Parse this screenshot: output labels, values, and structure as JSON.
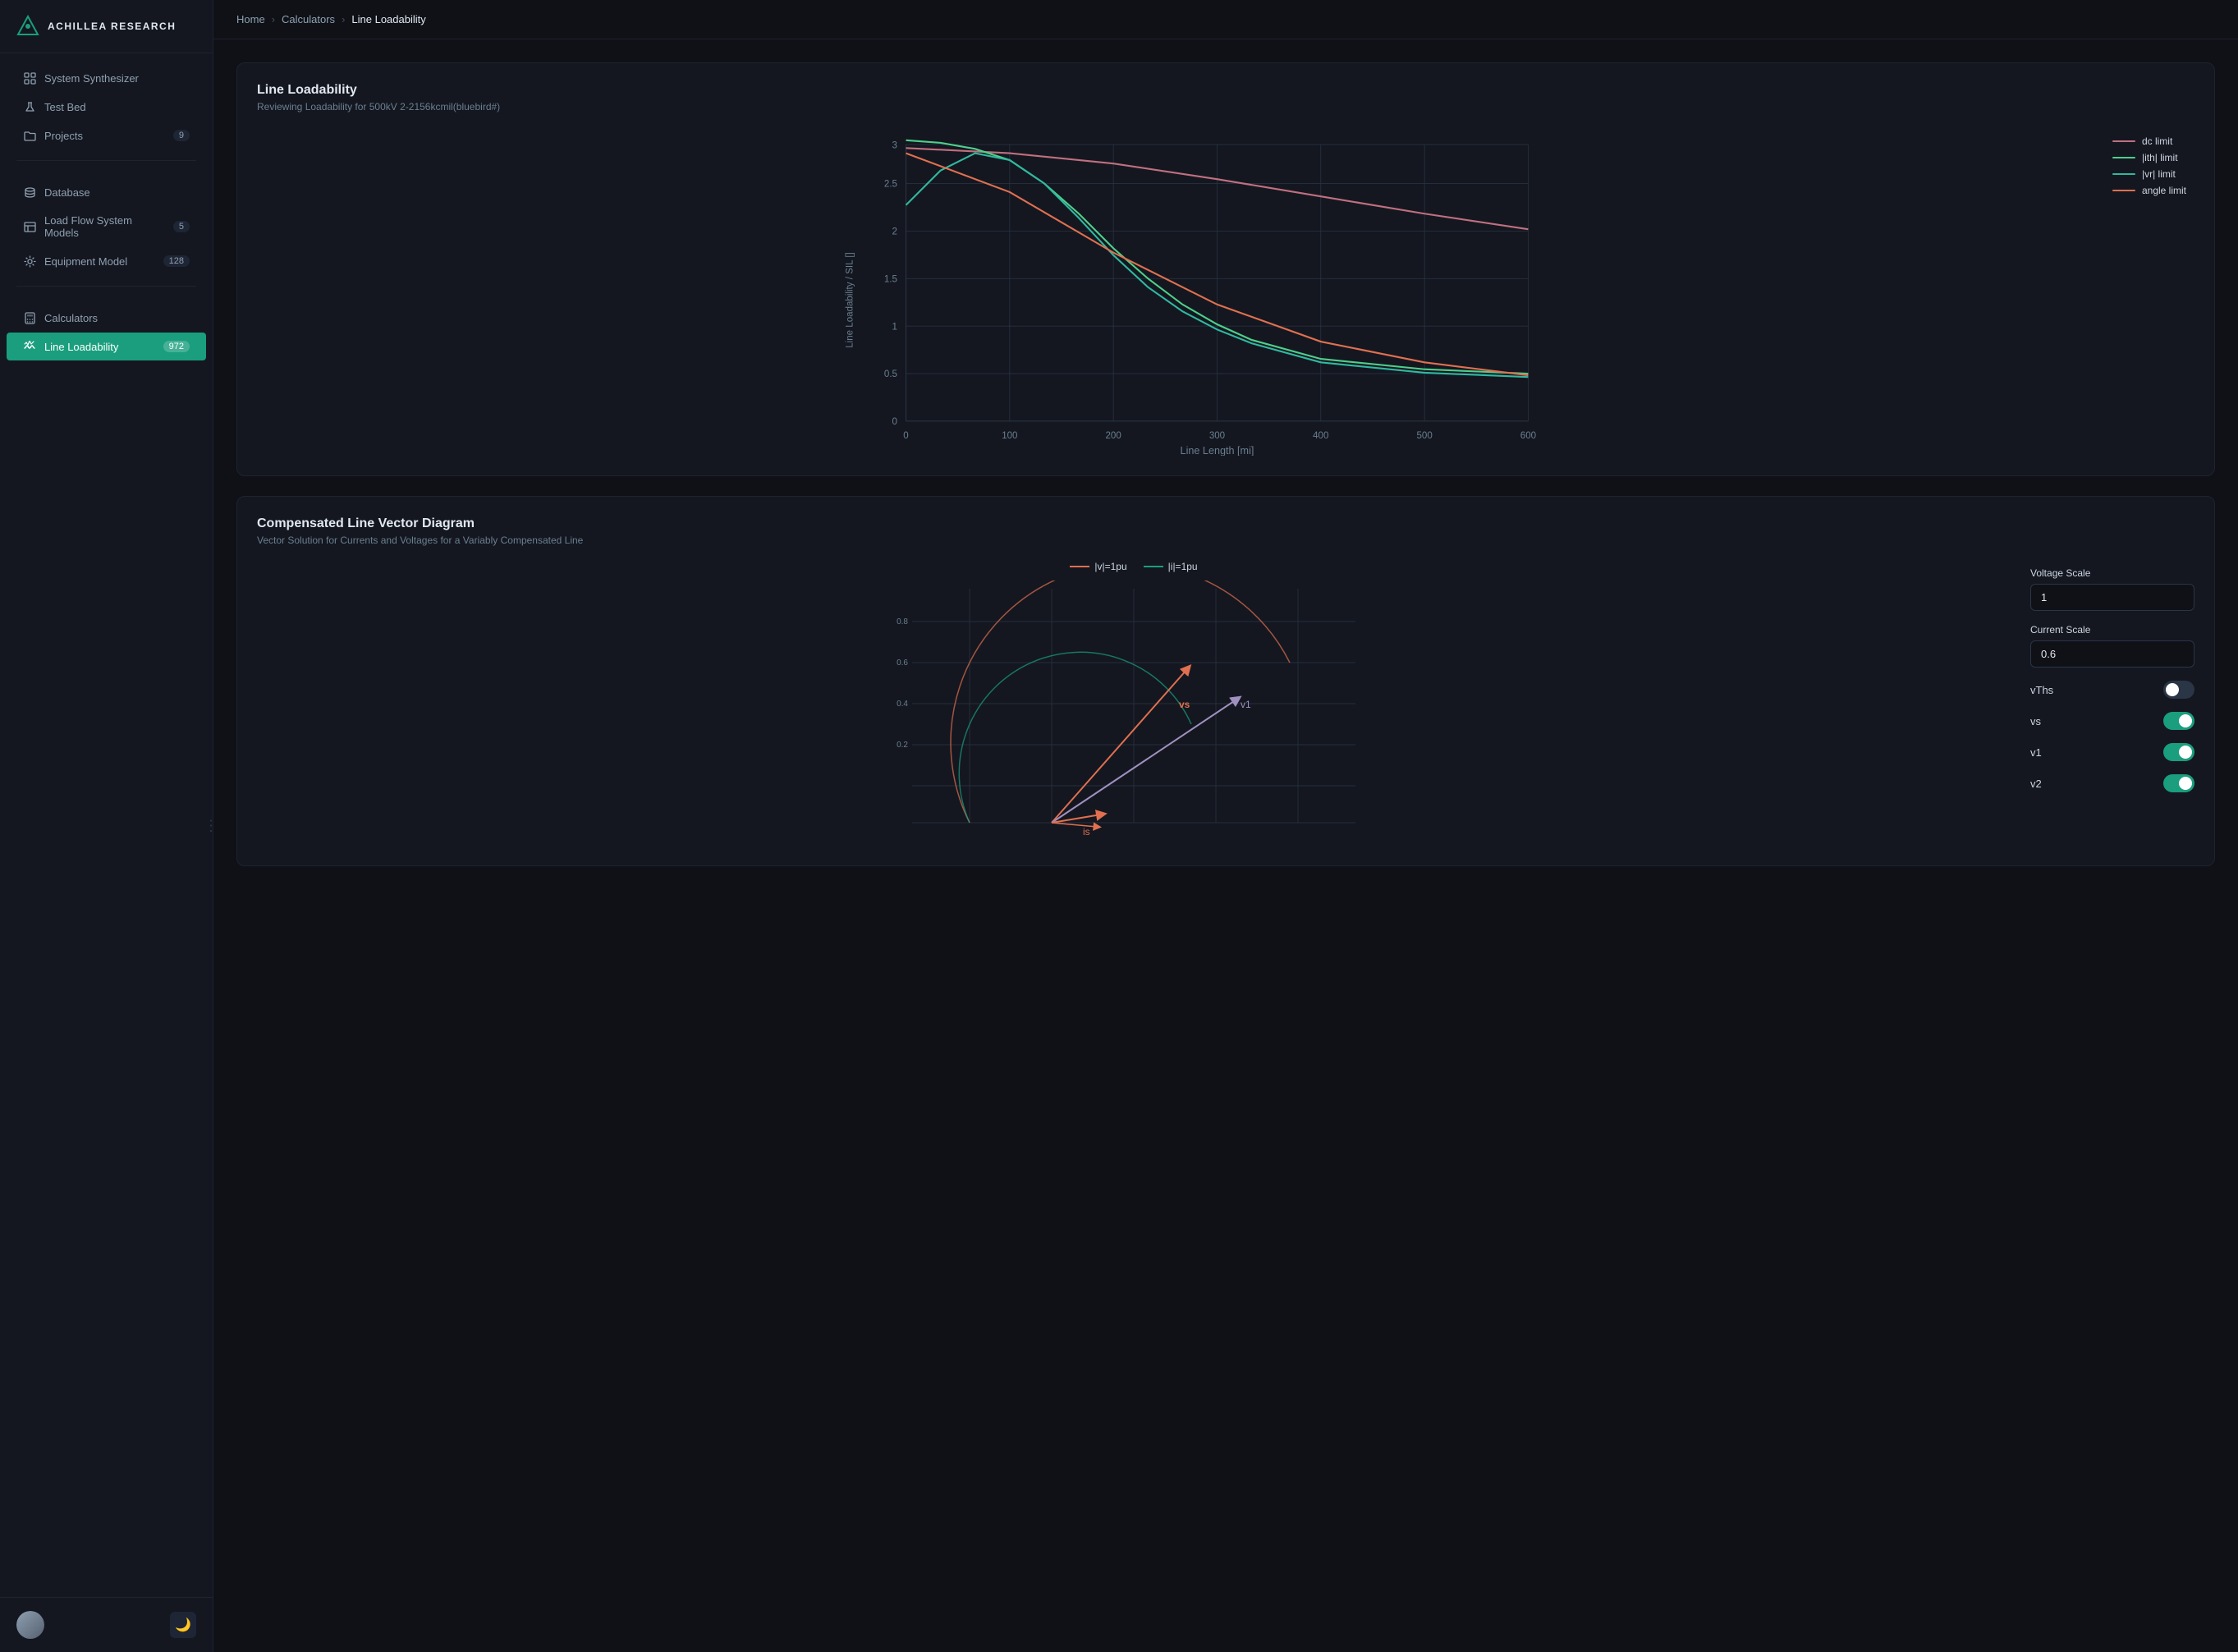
{
  "app": {
    "name": "ACHILLEA RESEARCH"
  },
  "breadcrumb": {
    "home": "Home",
    "calculators": "Calculators",
    "current": "Line Loadability"
  },
  "sidebar": {
    "items": [
      {
        "id": "system-synthesizer",
        "label": "System Synthesizer",
        "icon": "grid",
        "badge": null,
        "active": false
      },
      {
        "id": "test-bed",
        "label": "Test Bed",
        "icon": "flask",
        "badge": null,
        "active": false
      },
      {
        "id": "projects",
        "label": "Projects",
        "icon": "folder",
        "badge": "9",
        "active": false
      },
      {
        "id": "database",
        "label": "Database",
        "icon": "database",
        "badge": null,
        "active": false
      },
      {
        "id": "load-flow",
        "label": "Load Flow System Models",
        "icon": "table",
        "badge": "5",
        "active": false
      },
      {
        "id": "equipment-model",
        "label": "Equipment Model",
        "icon": "gear",
        "badge": "128",
        "active": false
      },
      {
        "id": "calculators",
        "label": "Calculators",
        "icon": "calc",
        "badge": null,
        "active": false
      },
      {
        "id": "line-loadability",
        "label": "Line Loadability",
        "icon": "wave",
        "badge": "972",
        "active": true
      }
    ]
  },
  "chart1": {
    "title": "Line Loadability",
    "subtitle": "Reviewing Loadability for 500kV 2-2156kcmil(bluebird#)",
    "yLabel": "Line Loadability / SIL []",
    "xLabel": "Line Length [mi]",
    "legend": [
      {
        "label": "dc limit",
        "color": "#c07080"
      },
      {
        "label": "|ith| limit",
        "color": "#4ecf8a"
      },
      {
        "label": "|vr| limit",
        "color": "#30b8a0"
      },
      {
        "label": "angle limit",
        "color": "#e07050"
      }
    ]
  },
  "chart2": {
    "title": "Compensated Line Vector Diagram",
    "subtitle": "Vector Solution for Currents and Voltages for a Variably Compensated Line",
    "legend": [
      {
        "label": "|v|=1pu",
        "color": "#e07050"
      },
      {
        "label": "|i|=1pu",
        "color": "#1a9e7e"
      }
    ],
    "controls": {
      "voltage_scale_label": "Voltage Scale",
      "voltage_scale_value": "1",
      "current_scale_label": "Current Scale",
      "current_scale_value": "0.6",
      "toggles": [
        {
          "id": "vThs",
          "label": "vThs",
          "on": false
        },
        {
          "id": "vs",
          "label": "vs",
          "on": true
        },
        {
          "id": "v1",
          "label": "v1",
          "on": true
        },
        {
          "id": "v2",
          "label": "v2",
          "on": true
        }
      ]
    },
    "labels": {
      "vs": "vs",
      "v1": "v1",
      "is": "is"
    }
  }
}
